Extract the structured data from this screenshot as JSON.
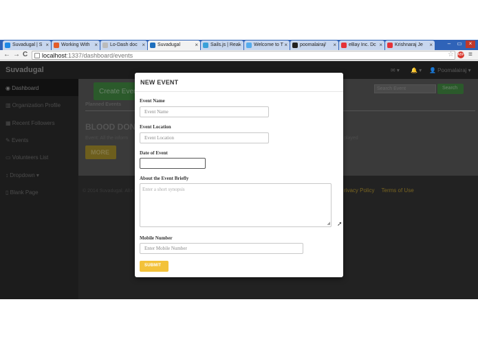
{
  "browser": {
    "tabs": [
      {
        "label": "Suvadugal | S",
        "active": false,
        "icon_color": "#1e88e5"
      },
      {
        "label": "Working With",
        "active": false,
        "icon_color": "#e35d2b"
      },
      {
        "label": "Lo-Dash doc",
        "active": false,
        "icon_color": "#bbbbbb"
      },
      {
        "label": "Suvadugal",
        "active": true,
        "icon_color": "#1e6fbd"
      },
      {
        "label": "Sails.js | Real",
        "active": false,
        "icon_color": "#3aa0d8"
      },
      {
        "label": "Welcome to T",
        "active": false,
        "icon_color": "#55acee"
      },
      {
        "label": "poomalairaj/",
        "active": false,
        "icon_color": "#222222"
      },
      {
        "label": "eBay Inc. Dc",
        "active": false,
        "icon_color": "#e53238"
      },
      {
        "label": "Krishnaraj Je",
        "active": false,
        "icon_color": "#e53238"
      }
    ],
    "close_glyph": "×",
    "window_controls": [
      "–",
      "▭",
      "×"
    ],
    "nav_back": "←",
    "nav_forward": "→",
    "nav_reload": "C",
    "url_host": "localhost",
    "url_path": ":1337/dashboard/events"
  },
  "app": {
    "brand": "Suvadugal",
    "nav_right": [
      "✉ ▾",
      "🔔 ▾",
      "👤 Poomalairaj ▾"
    ],
    "sidebar": [
      {
        "label": "Dashboard",
        "icon": "dashboard-icon",
        "glyph": "◉"
      },
      {
        "label": "Organization Profile",
        "icon": "chart-icon",
        "glyph": "▥"
      },
      {
        "label": "Recent Followers",
        "icon": "table-icon",
        "glyph": "▦"
      },
      {
        "label": "Events",
        "icon": "edit-icon",
        "glyph": "✎"
      },
      {
        "label": "Volunteers List",
        "icon": "desktop-icon",
        "glyph": "▭"
      },
      {
        "label": "Dropdown ▾",
        "icon": "arrows-icon",
        "glyph": "↕"
      },
      {
        "label": "Blank Page",
        "icon": "file-icon",
        "glyph": "▯"
      }
    ],
    "create_button": "Create Event",
    "search_placeholder": "Search Event",
    "search_button": "Search",
    "planned_events": "Planned Events",
    "event_title": "BLOOD DON",
    "event_desc": "Event: All the inform",
    "event_desc_tail": "played",
    "more_button": "MORE",
    "footer_left": "© 2014 Suvadugal. All r",
    "footer_links": [
      "rivacy Policy",
      "Terms of Use"
    ]
  },
  "modal": {
    "title": "NEW EVENT",
    "fields": {
      "event_name": {
        "label": "Event Name",
        "placeholder": "Event Name"
      },
      "event_location": {
        "label": "Event Location",
        "placeholder": "Event Location"
      },
      "date": {
        "label": "Date of Event",
        "value": ""
      },
      "about": {
        "label": "About the Event Briefly",
        "placeholder": "Enter a short synopsis"
      },
      "mobile": {
        "label": "Mobile Number",
        "placeholder": "Enter Mobile Number"
      }
    },
    "submit": "SUBMIT"
  },
  "colors": {
    "accent_yellow": "#f3c23a",
    "tabstrip_blue": "#2f63b8",
    "dim_green": "#2b5a2b"
  }
}
